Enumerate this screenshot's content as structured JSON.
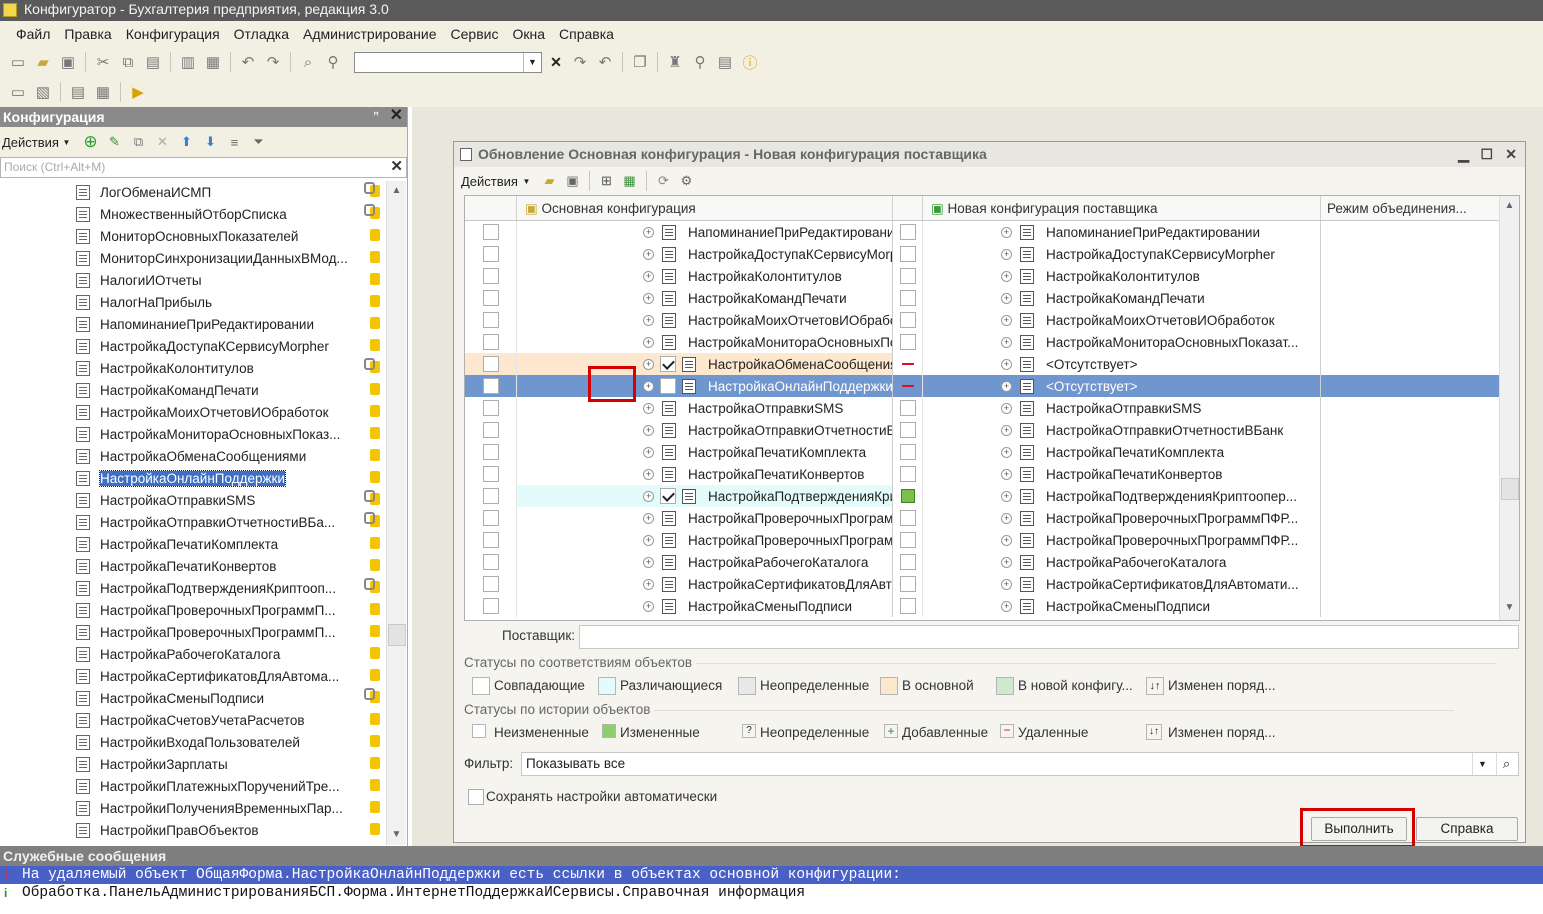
{
  "window": {
    "title": "Конфигуратор - Бухгалтерия предприятия, редакция 3.0"
  },
  "menu": [
    "Файл",
    "Правка",
    "Конфигурация",
    "Отладка",
    "Администрирование",
    "Сервис",
    "Окна",
    "Справка"
  ],
  "left_panel": {
    "title": "Конфигурация",
    "actions_label": "Действия",
    "search_placeholder": "Поиск (Ctrl+Alt+M)",
    "items": [
      {
        "label": "ЛогОбменаИСМП",
        "lock": true
      },
      {
        "label": "МножественныйОтборСписка",
        "lock": true
      },
      {
        "label": "МониторОсновныхПоказателей",
        "lock": false
      },
      {
        "label": "МониторСинхронизацииДанныхВМод...",
        "lock": false
      },
      {
        "label": "НалогиИОтчеты",
        "lock": false
      },
      {
        "label": "НалогНаПрибыль",
        "lock": false
      },
      {
        "label": "НапоминаниеПриРедактировании",
        "lock": false
      },
      {
        "label": "НастройкаДоступаКСервисуMorpher",
        "lock": false
      },
      {
        "label": "НастройкаКолонтитулов",
        "lock": true
      },
      {
        "label": "НастройкаКомандПечати",
        "lock": false
      },
      {
        "label": "НастройкаМоихОтчетовИОбработок",
        "lock": false
      },
      {
        "label": "НастройкаМонитораОсновныхПоказ...",
        "lock": false
      },
      {
        "label": "НастройкаОбменаСообщениями",
        "lock": false
      },
      {
        "label": "НастройкаОнлайнПоддержки",
        "lock": false,
        "selected": true
      },
      {
        "label": "НастройкаОтправкиSMS",
        "lock": true
      },
      {
        "label": "НастройкаОтправкиОтчетностиВБа...",
        "lock": true
      },
      {
        "label": "НастройкаПечатиКомплекта",
        "lock": false
      },
      {
        "label": "НастройкаПечатиКонвертов",
        "lock": false
      },
      {
        "label": "НастройкаПодтвержденияКриптооп...",
        "lock": true
      },
      {
        "label": "НастройкаПроверочныхПрограммП...",
        "lock": false
      },
      {
        "label": "НастройкаПроверочныхПрограммП...",
        "lock": false
      },
      {
        "label": "НастройкаРабочегоКаталога",
        "lock": false
      },
      {
        "label": "НастройкаСертификатовДляАвтома...",
        "lock": false
      },
      {
        "label": "НастройкаСменыПодписи",
        "lock": true
      },
      {
        "label": "НастройкаСчетовУчетаРасчетов",
        "lock": false
      },
      {
        "label": "НастройкиВходаПользователей",
        "lock": false
      },
      {
        "label": "НастройкиЗарплаты",
        "lock": false
      },
      {
        "label": "НастройкиПлатежныхПорученийТре...",
        "lock": false
      },
      {
        "label": "НастройкиПолученияВременныхПар...",
        "lock": false
      },
      {
        "label": "НастройкиПравОбъектов",
        "lock": false
      }
    ]
  },
  "dialog": {
    "title": "Обновление Основная конфигурация - Новая конфигурация поставщика",
    "actions_label": "Действия",
    "columns": {
      "main": "Основная конфигурация",
      "new": "Новая конфигурация поставщика",
      "mode": "Режим объединения..."
    },
    "rows": [
      {
        "left": "НапоминаниеПриРедактировании",
        "right": "НапоминаниеПриРедактировании",
        "style": ""
      },
      {
        "left": "НастройкаДоступаКСервисуMorpher",
        "right": "НастройкаДоступаКСервисуMorpher",
        "style": ""
      },
      {
        "left": "НастройкаКолонтитулов",
        "right": "НастройкаКолонтитулов",
        "style": ""
      },
      {
        "left": "НастройкаКомандПечати",
        "right": "НастройкаКомандПечати",
        "style": ""
      },
      {
        "left": "НастройкаМоихОтчетовИОбработок",
        "right": "НастройкаМоихОтчетовИОбработок",
        "style": ""
      },
      {
        "left": "НастройкаМонитораОсновныхПока...",
        "right": "НастройкаМонитораОсновныхПоказат...",
        "style": ""
      },
      {
        "left": "НастройкаОбменаСообщениями",
        "right": "<Отсутствует>",
        "style": "orange",
        "checked": true,
        "mark": "minus"
      },
      {
        "left": "НастройкаОнлайнПоддержки",
        "right": "<Отсутствует>",
        "style": "sel",
        "checked": false,
        "mark": "minus"
      },
      {
        "left": "НастройкаОтправкиSMS",
        "right": "НастройкаОтправкиSMS",
        "style": ""
      },
      {
        "left": "НастройкаОтправкиОтчетностиВБа...",
        "right": "НастройкаОтправкиОтчетностиВБанк",
        "style": ""
      },
      {
        "left": "НастройкаПечатиКомплекта",
        "right": "НастройкаПечатиКомплекта",
        "style": ""
      },
      {
        "left": "НастройкаПечатиКонвертов",
        "right": "НастройкаПечатиКонвертов",
        "style": ""
      },
      {
        "left": "НастройкаПодтвержденияКрипт...",
        "right": "НастройкаПодтвержденияКриптоопер...",
        "style": "cyan",
        "checked": true,
        "mark": "pencil"
      },
      {
        "left": "НастройкаПроверочныхПрограммП...",
        "right": "НастройкаПроверочныхПрограммПФР...",
        "style": ""
      },
      {
        "left": "НастройкаПроверочныхПрограммП...",
        "right": "НастройкаПроверочныхПрограммПФР...",
        "style": ""
      },
      {
        "left": "НастройкаРабочегоКаталога",
        "right": "НастройкаРабочегоКаталога",
        "style": ""
      },
      {
        "left": "НастройкаСертификатовДляАвтом...",
        "right": "НастройкаСертификатовДляАвтомати...",
        "style": ""
      },
      {
        "left": "НастройкаСменыПодписи",
        "right": "НастройкаСменыПодписи",
        "style": ""
      }
    ],
    "supplier_label": "Поставщик:",
    "status_match_title": "Статусы по соответствиям объектов",
    "status_match": [
      "Совпадающие",
      "Различающиеся",
      "Неопределенные",
      "В основной",
      "В новой конфигу...",
      "Изменен поряд..."
    ],
    "status_history_title": "Статусы по истории объектов",
    "status_history": [
      "Неизмененные",
      "Измененные",
      "Неопределенные",
      "Добавленные",
      "Удаленные",
      "Изменен поряд..."
    ],
    "filter_label": "Фильтр:",
    "filter_value": "Показывать все",
    "autosave_label": "Сохранять настройки автоматически",
    "execute_button": "Выполнить",
    "help_button": "Справка"
  },
  "messages": {
    "title": "Служебные сообщения",
    "lines": [
      "На удаляемый объект ОбщаяФорма.НастройкаОнлайнПоддержки есть ссылки в объектах основной конфигурации:",
      "Обработка.ПанельАдминистрированияБСП.Форма.ИнтернетПоддержкаИСервисы.Справочная информация"
    ]
  }
}
